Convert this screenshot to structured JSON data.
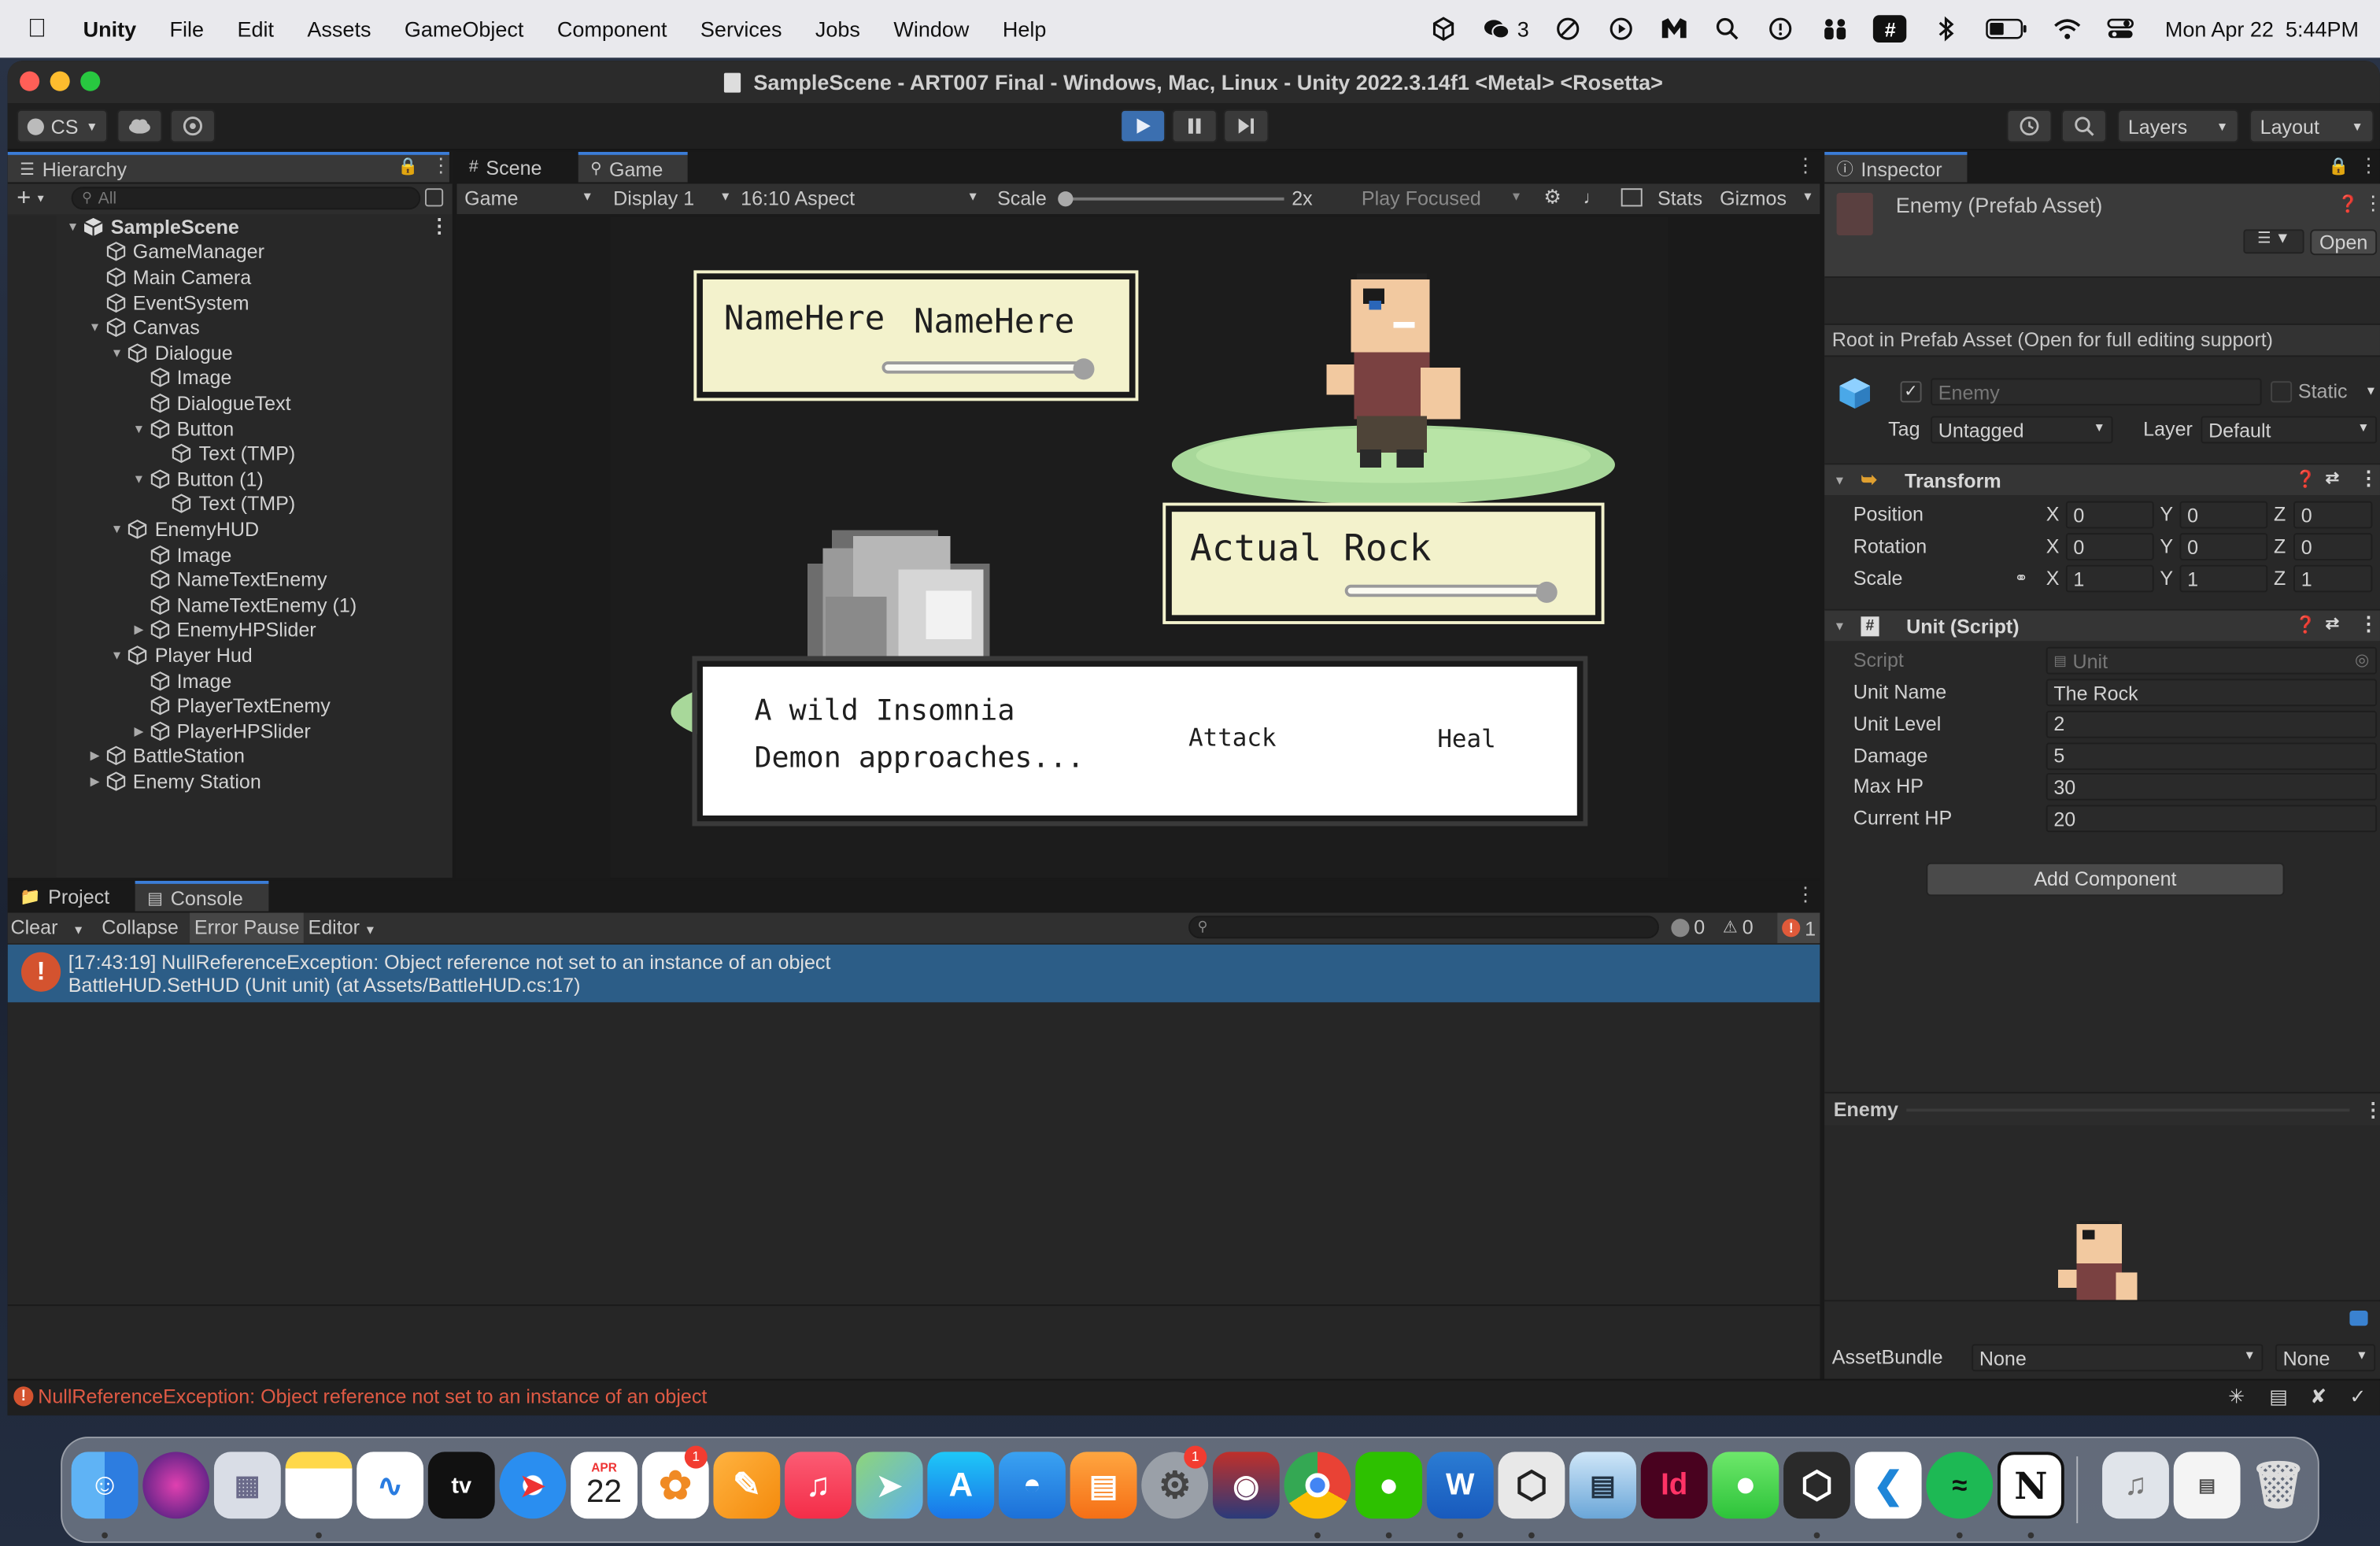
{
  "menubar": {
    "app": "Unity",
    "items": [
      "File",
      "Edit",
      "Assets",
      "GameObject",
      "Component",
      "Services",
      "Jobs",
      "Window",
      "Help"
    ],
    "wechat_count": "3",
    "datetime": "Mon Apr 22  5:44PM"
  },
  "window": {
    "title": "SampleScene - ART007 Final - Windows, Mac, Linux - Unity 2022.3.14f1 <Metal> <Rosetta>",
    "account": "CS",
    "layers": "Layers",
    "layout": "Layout"
  },
  "hierarchy": {
    "tab": "Hierarchy",
    "search_placeholder": "All",
    "rows": [
      {
        "label": "SampleScene",
        "depth": 0,
        "arrow": "down",
        "bold": true,
        "scene": true
      },
      {
        "label": "GameManager",
        "depth": 1,
        "arrow": ""
      },
      {
        "label": "Main Camera",
        "depth": 1,
        "arrow": ""
      },
      {
        "label": "EventSystem",
        "depth": 1,
        "arrow": ""
      },
      {
        "label": "Canvas",
        "depth": 1,
        "arrow": "down"
      },
      {
        "label": "Dialogue",
        "depth": 2,
        "arrow": "down"
      },
      {
        "label": "Image",
        "depth": 3,
        "arrow": ""
      },
      {
        "label": "DialogueText",
        "depth": 3,
        "arrow": ""
      },
      {
        "label": "Button",
        "depth": 3,
        "arrow": "down"
      },
      {
        "label": "Text (TMP)",
        "depth": 4,
        "arrow": ""
      },
      {
        "label": "Button (1)",
        "depth": 3,
        "arrow": "down"
      },
      {
        "label": "Text (TMP)",
        "depth": 4,
        "arrow": ""
      },
      {
        "label": "EnemyHUD",
        "depth": 2,
        "arrow": "down"
      },
      {
        "label": "Image",
        "depth": 3,
        "arrow": ""
      },
      {
        "label": "NameTextEnemy",
        "depth": 3,
        "arrow": ""
      },
      {
        "label": "NameTextEnemy (1)",
        "depth": 3,
        "arrow": ""
      },
      {
        "label": "EnemyHPSlider",
        "depth": 3,
        "arrow": "right"
      },
      {
        "label": "Player Hud",
        "depth": 2,
        "arrow": "down"
      },
      {
        "label": "Image",
        "depth": 3,
        "arrow": ""
      },
      {
        "label": "PlayerTextEnemy",
        "depth": 3,
        "arrow": ""
      },
      {
        "label": "PlayerHPSlider",
        "depth": 3,
        "arrow": "right"
      },
      {
        "label": "BattleStation",
        "depth": 1,
        "arrow": "right"
      },
      {
        "label": "Enemy Station",
        "depth": 1,
        "arrow": "right"
      }
    ]
  },
  "gameview": {
    "tabs": [
      "Scene",
      "Game"
    ],
    "mode": "Game",
    "display": "Display 1",
    "aspect": "16:10 Aspect",
    "scale_label": "Scale",
    "scale_value": "2x",
    "play_focused": "Play Focused",
    "stats": "Stats",
    "gizmos": "Gizmos"
  },
  "game": {
    "enemy_name_1": "NameHere",
    "enemy_name_2": "NameHere",
    "player_name": "Actual Rock",
    "dialogue": "A wild Insomnia Demon approaches...",
    "attack": "Attack",
    "heal": "Heal"
  },
  "console": {
    "tabs": [
      "Project",
      "Console"
    ],
    "clear": "Clear",
    "collapse": "Collapse",
    "error_pause": "Error Pause",
    "editor": "Editor",
    "count_info": "0",
    "count_warn": "0",
    "count_error": "1",
    "entry_line1": "[17:43:19] NullReferenceException: Object reference not set to an instance of an object",
    "entry_line2": "BattleHUD.SetHUD (Unit unit) (at Assets/BattleHUD.cs:17)",
    "status": "NullReferenceException: Object reference not set to an instance of an object"
  },
  "inspector": {
    "tab": "Inspector",
    "asset_title": "Enemy (Prefab Asset)",
    "open": "Open",
    "root_note": "Root in Prefab Asset (Open for full editing support)",
    "object_name": "Enemy",
    "static": "Static",
    "tag_label": "Tag",
    "tag_value": "Untagged",
    "layer_label": "Layer",
    "layer_value": "Default",
    "transform": {
      "title": "Transform",
      "rows": [
        {
          "label": "Position",
          "x": "0",
          "y": "0",
          "z": "0"
        },
        {
          "label": "Rotation",
          "x": "0",
          "y": "0",
          "z": "0"
        },
        {
          "label": "Scale",
          "x": "1",
          "y": "1",
          "z": "1"
        }
      ]
    },
    "unit": {
      "title": "Unit (Script)",
      "script_label": "Script",
      "script_value": "Unit",
      "fields": [
        {
          "label": "Unit Name",
          "value": "The Rock"
        },
        {
          "label": "Unit Level",
          "value": "2"
        },
        {
          "label": "Damage",
          "value": "5"
        },
        {
          "label": "Max HP",
          "value": "30"
        },
        {
          "label": "Current HP",
          "value": "20"
        }
      ]
    },
    "add_component": "Add Component",
    "preview_title": "Enemy",
    "assetbundle_label": "AssetBundle",
    "assetbundle_value": "None",
    "assetbundle_variant": "None"
  },
  "dock": {
    "calendar_month": "APR",
    "calendar_day": "22",
    "badge_photos": "1",
    "badge_settings": "1",
    "tv_label": "tv",
    "indesign_label": "Id",
    "word_label": "W"
  }
}
